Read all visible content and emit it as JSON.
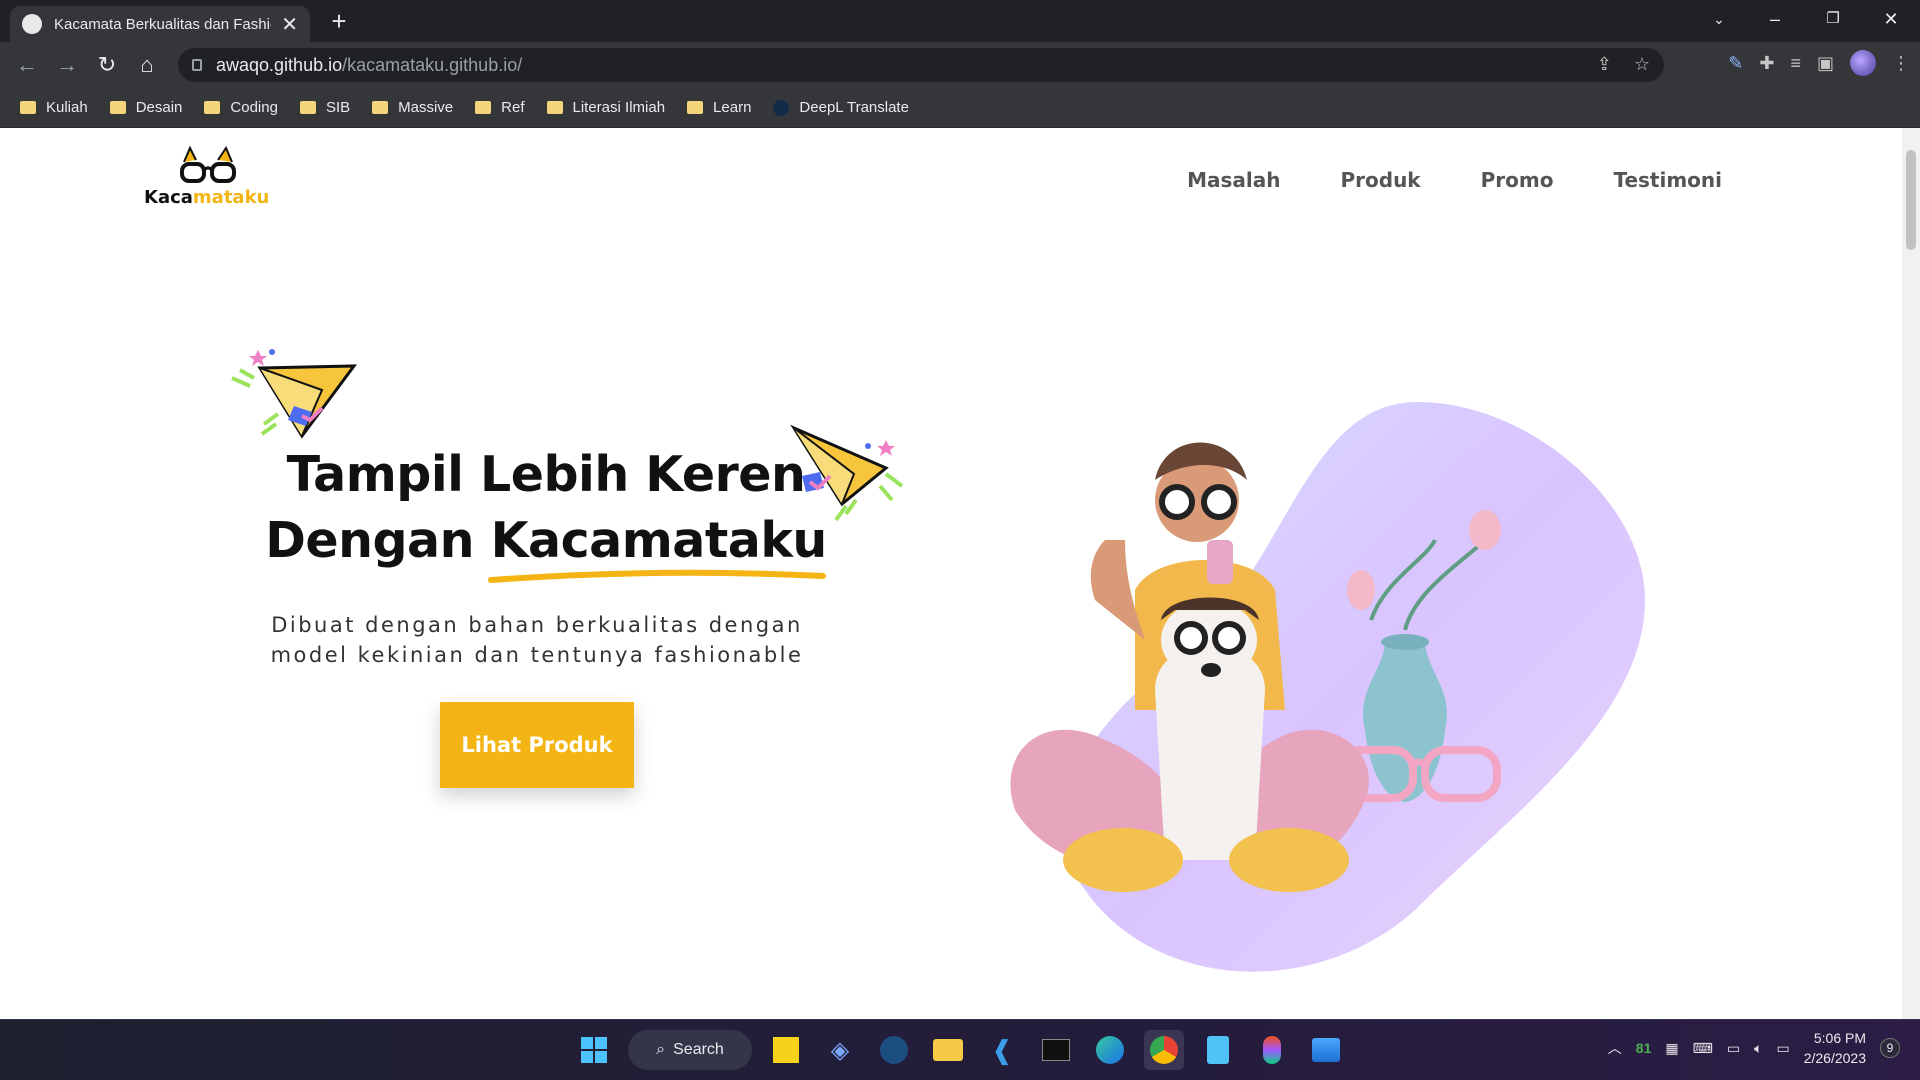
{
  "browser": {
    "tab_title": "Kacamata Berkualitas dan Fashion",
    "url_host": "awaqo.github.io",
    "url_path": "/kacamataku.github.io/",
    "bookmarks": [
      "Kuliah",
      "Desain",
      "Coding",
      "SIB",
      "Massive",
      "Ref",
      "Literasi Ilmiah",
      "Learn",
      "DeepL Translate"
    ]
  },
  "site": {
    "logo_text_a": "Kaca",
    "logo_text_b": "mataku",
    "nav": [
      "Masalah",
      "Produk",
      "Promo",
      "Testimoni"
    ],
    "hero_line1": "Tampil Lebih Keren",
    "hero_line2_a": "Dengan",
    "hero_line2_b": "Kacamataku",
    "hero_sub_1": "Dibuat dengan bahan berkualitas dengan",
    "hero_sub_2": "model kekinian dan tentunya fashionable",
    "cta": "Lihat Produk",
    "accent": "#f4b514"
  },
  "taskbar": {
    "search_label": "Search",
    "tray_number": "81",
    "time": "5:06 PM",
    "date": "2/26/2023",
    "notifications": "9"
  }
}
